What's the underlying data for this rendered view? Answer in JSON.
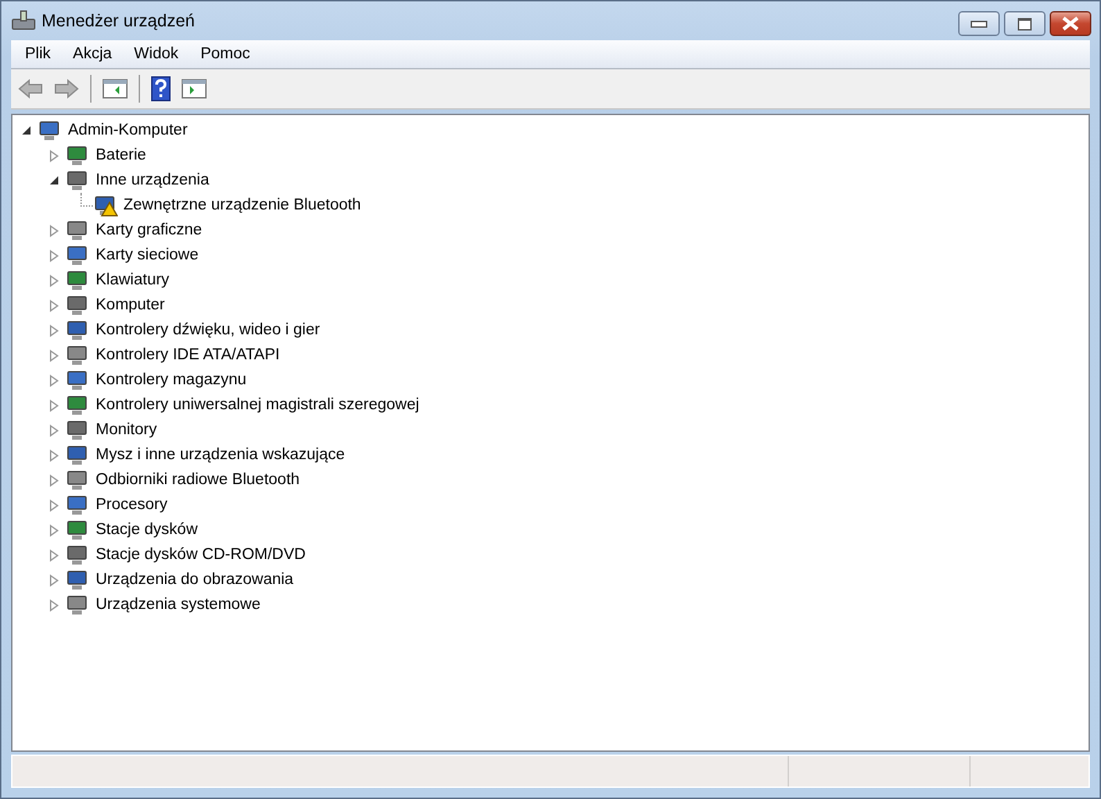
{
  "window": {
    "title": "Menedżer urządzeń"
  },
  "menu": [
    "Plik",
    "Akcja",
    "Widok",
    "Pomoc"
  ],
  "tree": {
    "label": "Admin-Komputer",
    "expanded": true,
    "warning": false,
    "children": [
      {
        "label": "Baterie",
        "expanded": false,
        "warning": false
      },
      {
        "label": "Inne urządzenia",
        "expanded": true,
        "warning": false,
        "children": [
          {
            "label": "Zewnętrzne urządzenie Bluetooth",
            "warning": true
          }
        ]
      },
      {
        "label": "Karty graficzne",
        "expanded": false,
        "warning": false
      },
      {
        "label": "Karty sieciowe",
        "expanded": false,
        "warning": false
      },
      {
        "label": "Klawiatury",
        "expanded": false,
        "warning": false
      },
      {
        "label": "Komputer",
        "expanded": false,
        "warning": false
      },
      {
        "label": "Kontrolery dźwięku, wideo i gier",
        "expanded": false,
        "warning": false
      },
      {
        "label": "Kontrolery IDE ATA/ATAPI",
        "expanded": false,
        "warning": false
      },
      {
        "label": "Kontrolery magazynu",
        "expanded": false,
        "warning": false
      },
      {
        "label": "Kontrolery uniwersalnej magistrali szeregowej",
        "expanded": false,
        "warning": false
      },
      {
        "label": "Monitory",
        "expanded": false,
        "warning": false
      },
      {
        "label": "Mysz i inne urządzenia wskazujące",
        "expanded": false,
        "warning": false
      },
      {
        "label": "Odbiorniki radiowe Bluetooth",
        "expanded": false,
        "warning": false
      },
      {
        "label": "Procesory",
        "expanded": false,
        "warning": false
      },
      {
        "label": "Stacje dysków",
        "expanded": false,
        "warning": false
      },
      {
        "label": "Stacje dysków CD-ROM/DVD",
        "expanded": false,
        "warning": false
      },
      {
        "label": "Urządzenia do obrazowania",
        "expanded": false,
        "warning": false
      },
      {
        "label": "Urządzenia systemowe",
        "expanded": false,
        "warning": false
      }
    ]
  }
}
